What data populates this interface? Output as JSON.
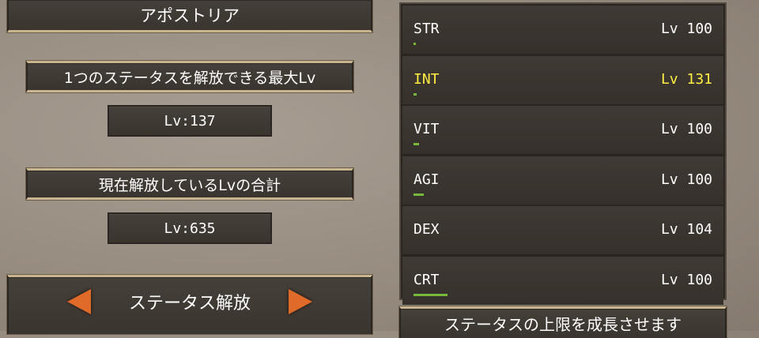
{
  "character_name": "アポストリア",
  "max_level_label": "1つのステータスを解放できる最大Lv",
  "max_level_value": "Lv:137",
  "total_level_label": "現在解放しているLvの合計",
  "total_level_value": "Lv:635",
  "mode_selector": {
    "label": "ステータス解放",
    "left_icon": "arrow-left-icon",
    "right_icon": "arrow-right-icon"
  },
  "stats": [
    {
      "name": "STR",
      "level": "Lv 100",
      "progress": 0.01,
      "highlight": false
    },
    {
      "name": "INT",
      "level": "Lv 131",
      "progress": 0.02,
      "highlight": true
    },
    {
      "name": "VIT",
      "level": "Lv 100",
      "progress": 0.04,
      "highlight": false
    },
    {
      "name": "AGI",
      "level": "Lv 100",
      "progress": 0.07,
      "highlight": false
    },
    {
      "name": "DEX",
      "level": "Lv 104",
      "progress": 0.0,
      "highlight": false
    },
    {
      "name": "CRT",
      "level": "Lv 100",
      "progress": 0.24,
      "highlight": false
    }
  ],
  "grow_button_label": "ステータスの上限を成長させます",
  "colors": {
    "highlight_text": "#ffee44",
    "progress_bar": "#78b83a",
    "arrow": "#e06a2a",
    "panel_trim": "#c8b48f"
  }
}
